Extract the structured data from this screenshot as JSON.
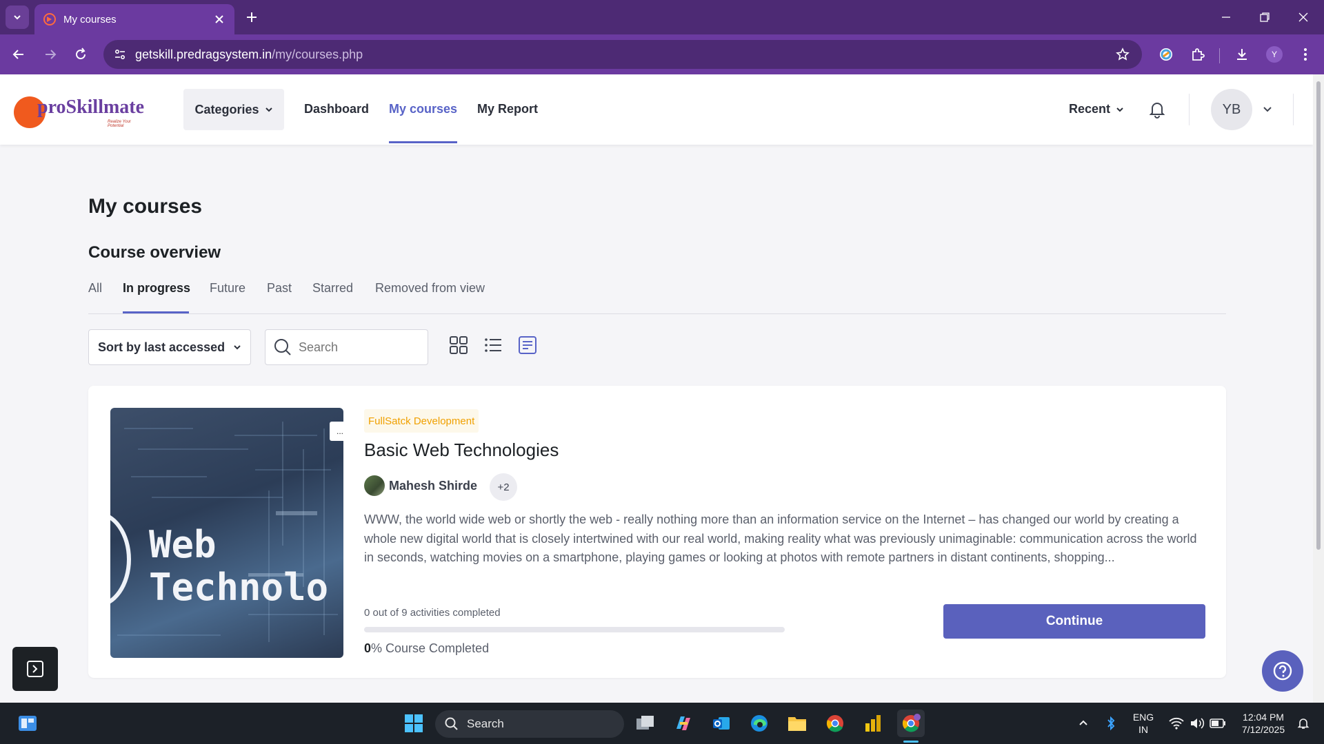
{
  "browser": {
    "tab_title": "My courses",
    "url_host": "getskill.predragsystem.in",
    "url_path": "/my/courses.php",
    "profile_initial": "Y"
  },
  "header": {
    "logo_text": "proSkillmate",
    "logo_tagline": "Realize Your Potential",
    "categories_label": "Categories",
    "nav": [
      "Dashboard",
      "My courses",
      "My Report"
    ],
    "active_nav": "My courses",
    "recent_label": "Recent",
    "user_initials": "YB"
  },
  "main": {
    "page_title": "My courses",
    "section_title": "Course overview",
    "filter_tabs": [
      "All",
      "In progress",
      "Future",
      "Past",
      "Starred",
      "Removed from view"
    ],
    "active_filter": "In progress",
    "sort_label": "Sort by last accessed",
    "search_placeholder": "Search"
  },
  "course": {
    "image_text": "Web Technolo",
    "category": "FullSatck Development",
    "title": "Basic Web Technologies",
    "teacher": "Mahesh Shirde",
    "more_teachers": "+2",
    "description": "WWW, the world wide web or shortly the web - really nothing more than an information service on the Internet – has changed our world by creating a whole new digital world that is closely intertwined with our real world, making reality what was previously unimaginable: communication across the world in seconds, watching movies on a smartphone, playing games or looking at photos with remote partners in distant continents, shopping...",
    "activities_text": "0 out of 9 activities completed",
    "progress_fraction": 0,
    "completion_percent": "0",
    "completion_suffix": "% Course Completed",
    "continue_label": "Continue",
    "menu_label": "..."
  },
  "taskbar": {
    "search_label": "Search",
    "lang_top": "ENG",
    "lang_bottom": "IN",
    "time": "12:04 PM",
    "date": "7/12/2025"
  },
  "colors": {
    "accent": "#5863c7",
    "browser_dark": "#4d2a74",
    "browser_light": "#6b3aa0",
    "category_badge": "#f0a000"
  }
}
